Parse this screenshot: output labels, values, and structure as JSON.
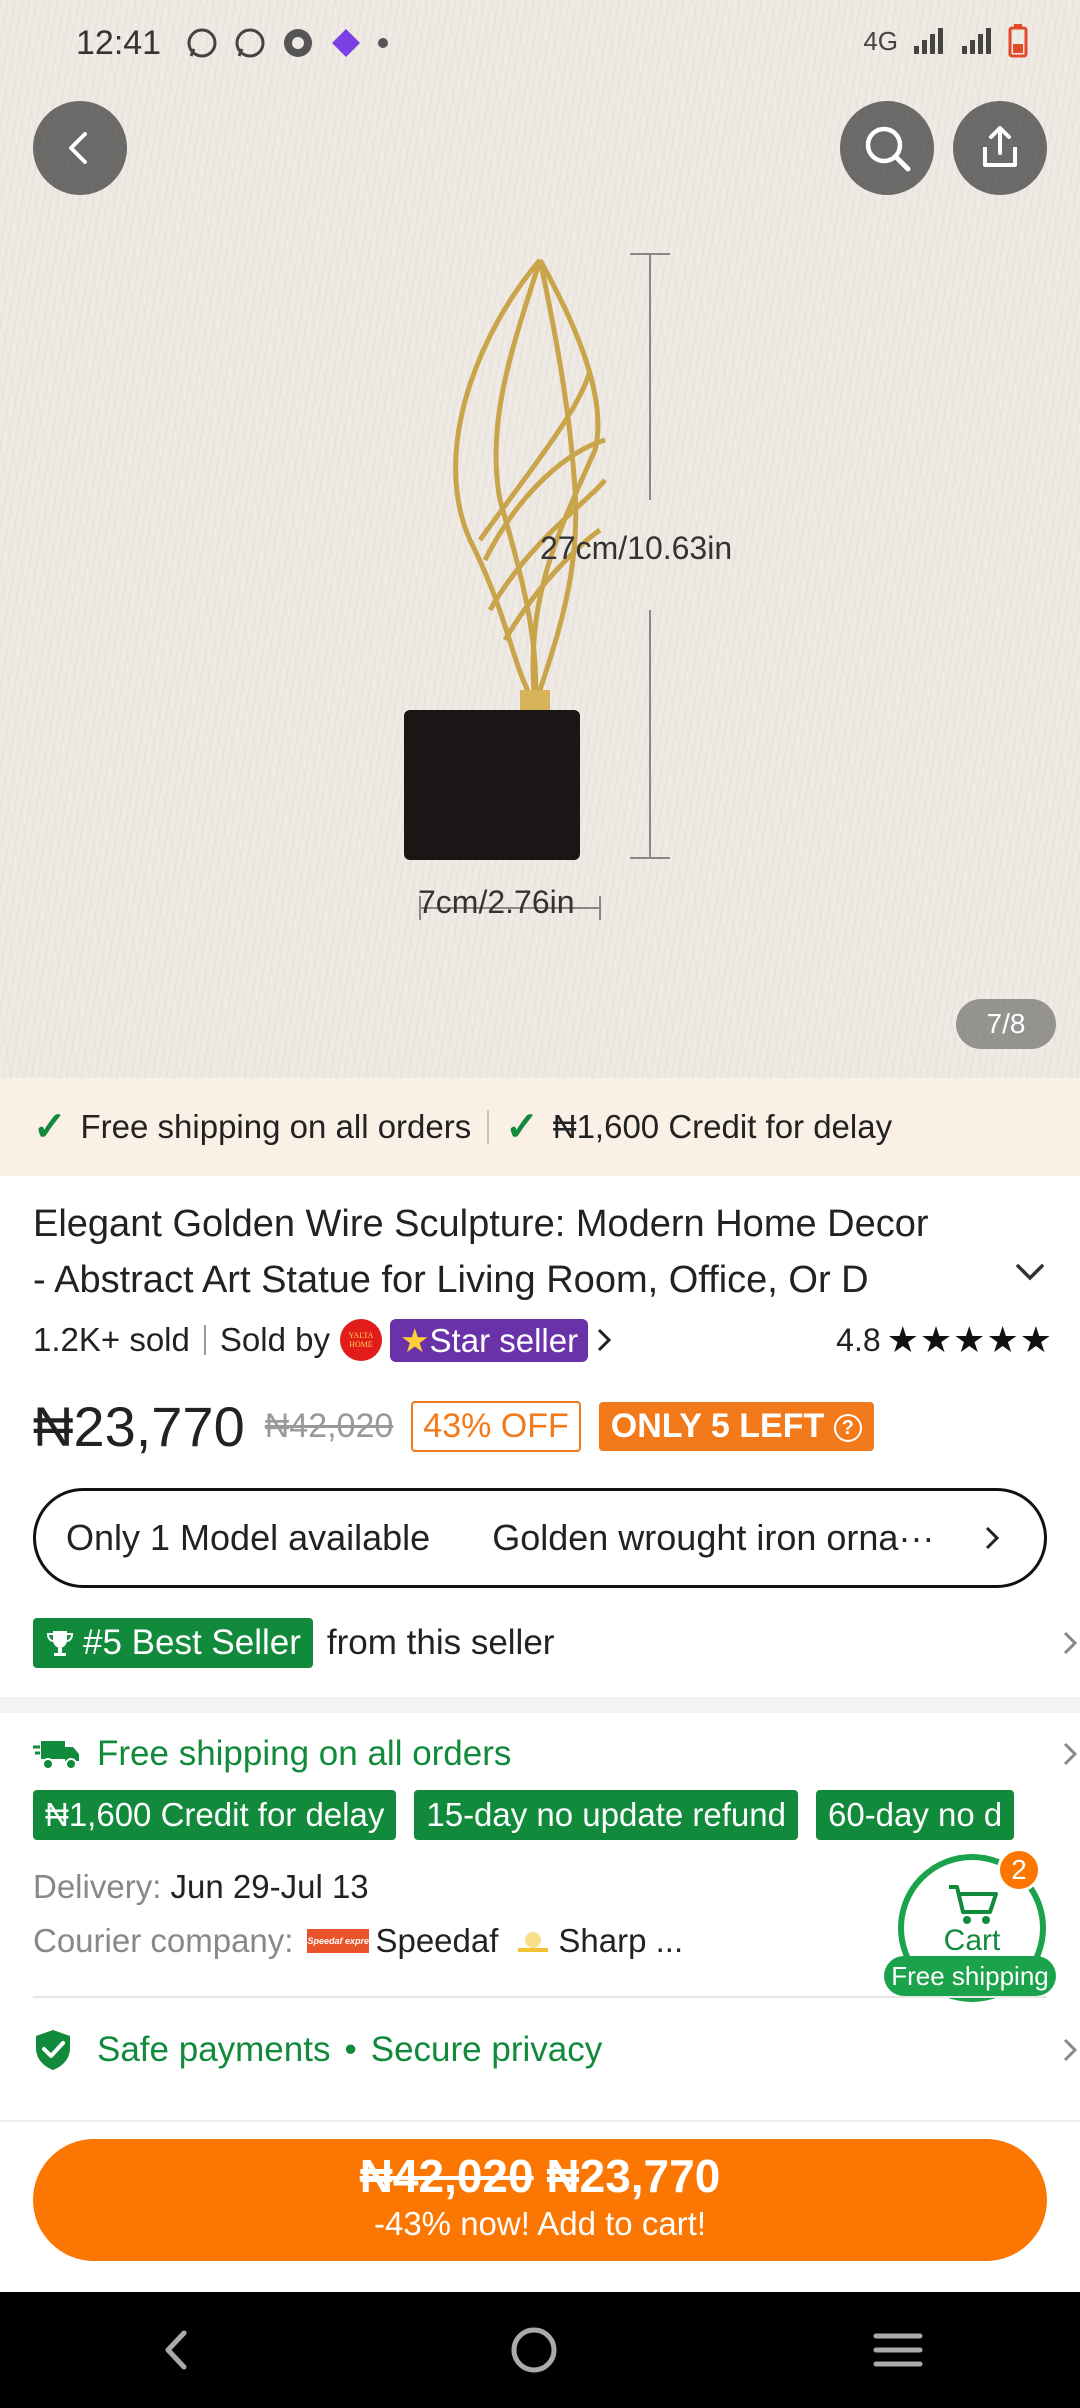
{
  "status_bar": {
    "time": "12:41",
    "network": "4G"
  },
  "hero": {
    "height_label": "27cm/10.63in",
    "width_label": "7cm/2.76in",
    "pager": "7/8"
  },
  "promo": {
    "item1": "Free shipping on all orders",
    "item2": "₦1,600 Credit for delay"
  },
  "product": {
    "title_line1": "Elegant Golden Wire Sculpture: Modern Home Decor",
    "title_line2": "- Abstract Art Statue for Living Room, Office, Or D",
    "sold": "1.2K+ sold",
    "sold_by": "Sold by",
    "seller_logo_text": "YALTA HOME",
    "seller_badge": "Star seller",
    "rating": "4.8",
    "stars": "★★★★★",
    "price": "₦23,770",
    "price_old": "₦42,020",
    "discount": "43% OFF",
    "stock": "ONLY 5 LEFT"
  },
  "model": {
    "availability": "Only 1 Model available",
    "option": "Golden wrought iron orna···"
  },
  "best_seller": {
    "badge": "#5 Best Seller",
    "text": "from this seller"
  },
  "shipping": {
    "title": "Free shipping on all orders",
    "tags": [
      "₦1,600 Credit for delay",
      "15-day no update refund",
      "60-day no d"
    ],
    "delivery_label": "Delivery:",
    "delivery_value": "Jun 29-Jul 13",
    "courier_label": "Courier company:",
    "courier1_logo": "Speedaf express",
    "courier1": "Speedaf",
    "courier2": "Sharp ..."
  },
  "cart": {
    "label": "Cart",
    "count": "2",
    "note": "Free shipping"
  },
  "safety": {
    "text1": "Safe payments",
    "sep": "•",
    "text2": "Secure privacy"
  },
  "cta": {
    "old_price": "₦42,020",
    "price": "₦23,770",
    "subtitle": "-43% now! Add to cart!"
  },
  "colors": {
    "accent": "#fb7701",
    "green": "#118a3b",
    "purple": "#6a32a8"
  }
}
